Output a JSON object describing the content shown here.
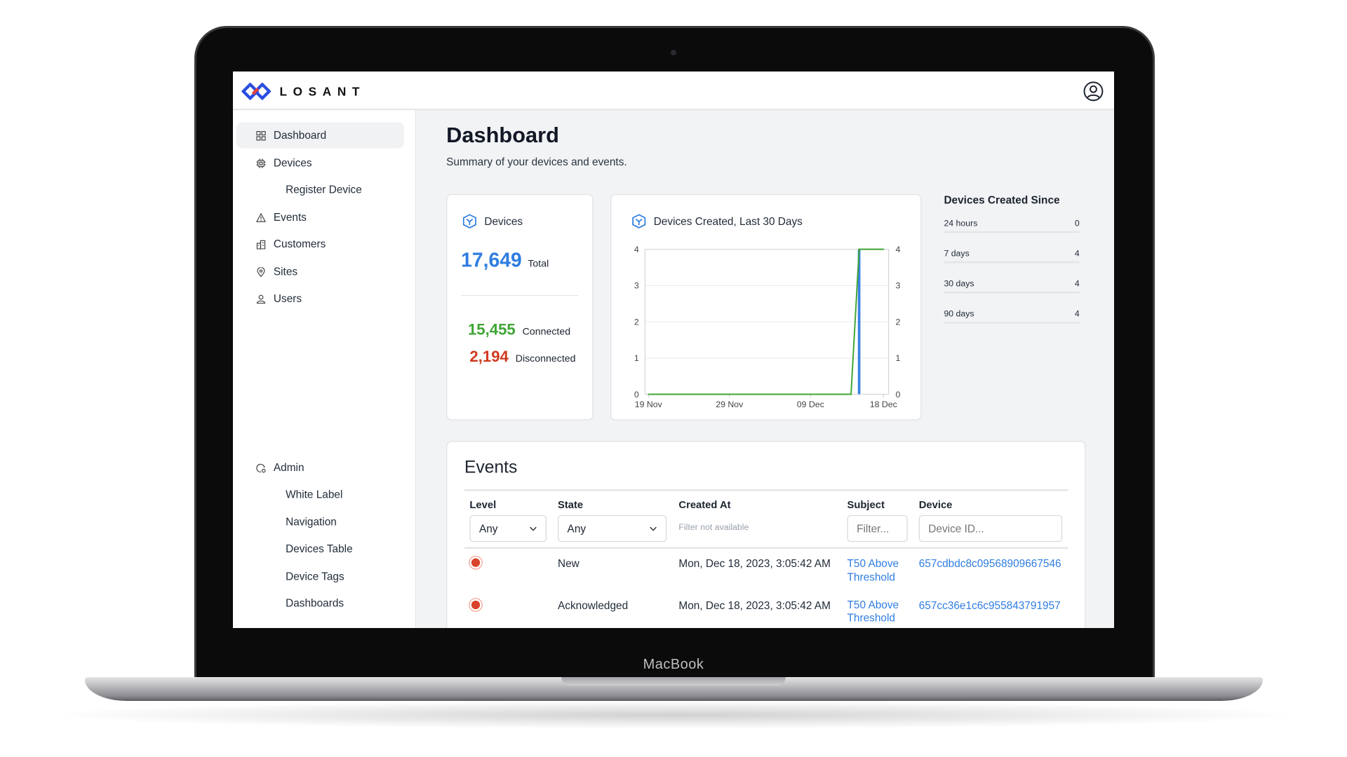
{
  "device_label": "MacBook",
  "app": {
    "brand": "LOSANT",
    "user_icon": "user-circle-icon"
  },
  "sidebar": {
    "items": [
      {
        "label": "Dashboard",
        "icon": "grid-icon",
        "active": true
      },
      {
        "label": "Devices",
        "icon": "chip-icon"
      },
      {
        "label": "Register Device",
        "sub": true
      },
      {
        "label": "Events",
        "icon": "warning-icon"
      },
      {
        "label": "Customers",
        "icon": "building-icon"
      },
      {
        "label": "Sites",
        "icon": "location-pin-icon"
      },
      {
        "label": "Users",
        "icon": "user-icon"
      }
    ],
    "admin": {
      "label": "Admin",
      "icon": "admin-icon",
      "items": [
        "White Label",
        "Navigation",
        "Devices Table",
        "Device Tags",
        "Dashboards"
      ]
    }
  },
  "page": {
    "title": "Dashboard",
    "subtitle": "Summary of your devices and events."
  },
  "devices_card": {
    "title": "Devices",
    "total": "17,649",
    "total_label": "Total",
    "connected": "15,455",
    "connected_label": "Connected",
    "disconnected": "2,194",
    "disconnected_label": "Disconnected",
    "colors": {
      "total": "#2f7de1",
      "connected": "#3fa535",
      "disconnected": "#d03a1f"
    }
  },
  "chart_data": {
    "type": "bar",
    "title": "Devices Created, Last 30 Days",
    "x_tick_labels": [
      "19 Nov",
      "29 Nov",
      "09 Dec",
      "18 Dec"
    ],
    "x_start": "2023-11-19",
    "x_end": "2023-12-18",
    "ylim": [
      0,
      4
    ],
    "y_ticks": [
      0,
      1,
      2,
      3,
      4
    ],
    "y2lim": [
      0,
      4
    ],
    "y2_ticks": [
      0,
      1,
      2,
      3,
      4
    ],
    "grid": true,
    "series": [
      {
        "type": "bar",
        "color": "#3b82e6",
        "points": [
          {
            "x": "2023-12-15",
            "y": 4
          }
        ]
      },
      {
        "type": "line",
        "color": "#3fa535",
        "axis": "right",
        "points": [
          {
            "x": "2023-11-19",
            "y": 0
          },
          {
            "x": "2023-12-14",
            "y": 0
          },
          {
            "x": "2023-12-15",
            "y": 4
          },
          {
            "x": "2023-12-18",
            "y": 4
          }
        ]
      }
    ]
  },
  "since": {
    "title": "Devices Created Since",
    "rows": [
      {
        "label": "24 hours",
        "value": "0"
      },
      {
        "label": "7 days",
        "value": "4"
      },
      {
        "label": "30 days",
        "value": "4"
      },
      {
        "label": "90 days",
        "value": "4"
      }
    ]
  },
  "events": {
    "title": "Events",
    "columns": [
      "Level",
      "State",
      "Created At",
      "Subject",
      "Device"
    ],
    "filters": {
      "level": "Any",
      "state": "Any",
      "created_at": "Filter not available",
      "subject_placeholder": "Filter...",
      "device_placeholder": "Device ID..."
    },
    "rows": [
      {
        "level": "critical",
        "state": "New",
        "created_at": "Mon, Dec 18, 2023, 3:05:42 AM",
        "subject": "T50 Above Threshold",
        "device": "657cdbdc8c09568909667546"
      },
      {
        "level": "critical",
        "state": "Acknowledged",
        "created_at": "Mon, Dec 18, 2023, 3:05:42 AM",
        "subject": "T50 Above Threshold",
        "device": "657cc36e1c6c955843791957"
      }
    ]
  }
}
